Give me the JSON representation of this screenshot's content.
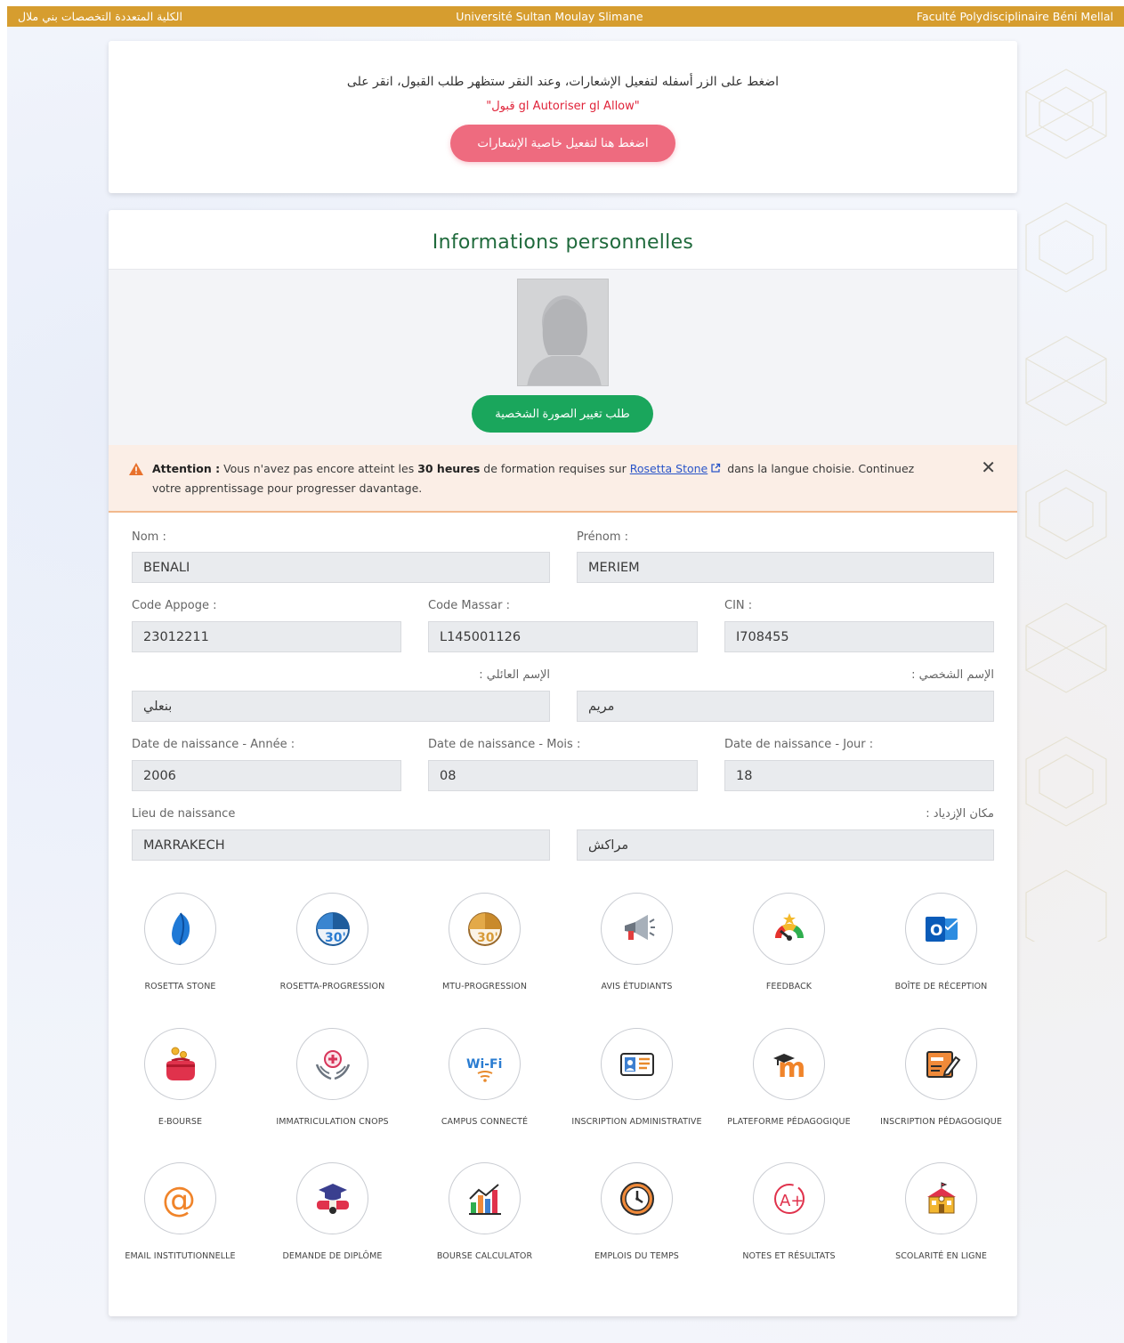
{
  "topbar": {
    "left_ar": "الكلية المتعددة التخصصات بني ملال",
    "center": "Université Sultan Moulay Slimane",
    "right": "Faculté Polydisciplinaire Béni Mellal"
  },
  "notification": {
    "text": "اضغط على الزر أسفله لتفعيل الإشعارات، وعند النقر ستظهر طلب القبول، انقر على",
    "allow_text": "\"قبول gl Autoriser gl Allow\"",
    "button_label": "اضغط هنا لتفعيل خاصية الإشعارات"
  },
  "info": {
    "title": "Informations personnelles",
    "photo_button": "طلب تغيير الصورة الشخصية"
  },
  "alert": {
    "strong": "Attention :",
    "text1": " Vous n'avez pas encore atteint les ",
    "hours": "30 heures",
    "text2": " de formation requises sur ",
    "link": "Rosetta Stone",
    "text3": " dans la langue choisie. Continuez votre apprentissage pour progresser davantage.",
    "close": "✕"
  },
  "fields": {
    "nom": {
      "label": "Nom :",
      "value": "BENALI"
    },
    "prenom": {
      "label": "Prénom :",
      "value": "MERIEM"
    },
    "code_appoge": {
      "label": "Code Appoge :",
      "value": "23012211"
    },
    "code_massar": {
      "label": "Code Massar :",
      "value": "L145001126"
    },
    "cin": {
      "label": "CIN :",
      "value": "I708455"
    },
    "nom_ar": {
      "label": "الإسم العائلي :",
      "value": "بنعلي"
    },
    "prenom_ar": {
      "label": "الإسم الشخصي :",
      "value": "مريم"
    },
    "annee": {
      "label": "Date de naissance - Année :",
      "value": "2006"
    },
    "mois": {
      "label": "Date de naissance - Mois :",
      "value": "08"
    },
    "jour": {
      "label": "Date de naissance - Jour :",
      "value": "18"
    },
    "lieu": {
      "label": "Lieu de naissance",
      "value": "MARRAKECH"
    },
    "lieu_ar": {
      "label": "مكان الإزدياد :",
      "value": "مراكش"
    }
  },
  "apps": [
    {
      "label": "ROSETTA STONE",
      "icon": "rosetta-stone-icon"
    },
    {
      "label": "ROSETTA-PROGRESSION",
      "icon": "rosetta-progression-icon",
      "badge": "30'"
    },
    {
      "label": "MTU-PROGRESSION",
      "icon": "mtu-progression-icon",
      "badge": "30'"
    },
    {
      "label": "AVIS ÉTUDIANTS",
      "icon": "megaphone-icon"
    },
    {
      "label": "FEEDBACK",
      "icon": "feedback-gauge-icon"
    },
    {
      "label": "BOÎTE DE RÉCEPTION",
      "icon": "outlook-icon",
      "badge": "O"
    },
    {
      "label": "E-BOURSE",
      "icon": "purse-icon"
    },
    {
      "label": "IMMATRICULATION CNOPS",
      "icon": "health-hands-icon"
    },
    {
      "label": "CAMPUS CONNECTÉ",
      "icon": "wifi-icon",
      "badge": "Wi-Fi"
    },
    {
      "label": "INSCRIPTION ADMINISTRATIVE",
      "icon": "id-card-icon"
    },
    {
      "label": "PLATEFORME PÉDAGOGIQUE",
      "icon": "moodle-icon",
      "badge": "m"
    },
    {
      "label": "INSCRIPTION PÉDAGOGIQUE",
      "icon": "edit-form-icon"
    },
    {
      "label": "EMAIL INSTITUTIONNELLE",
      "icon": "at-sign-icon",
      "badge": "@"
    },
    {
      "label": "DEMANDE DE DIPLÔME",
      "icon": "graduation-icon"
    },
    {
      "label": "BOURSE CALCULATOR",
      "icon": "bar-chart-icon"
    },
    {
      "label": "EMPLOIS DU TEMPS",
      "icon": "clock-icon"
    },
    {
      "label": "NOTES ET RÉSULTATS",
      "icon": "grade-icon",
      "badge": "A+"
    },
    {
      "label": "SCOLARITÉ EN LIGNE",
      "icon": "school-building-icon"
    }
  ]
}
